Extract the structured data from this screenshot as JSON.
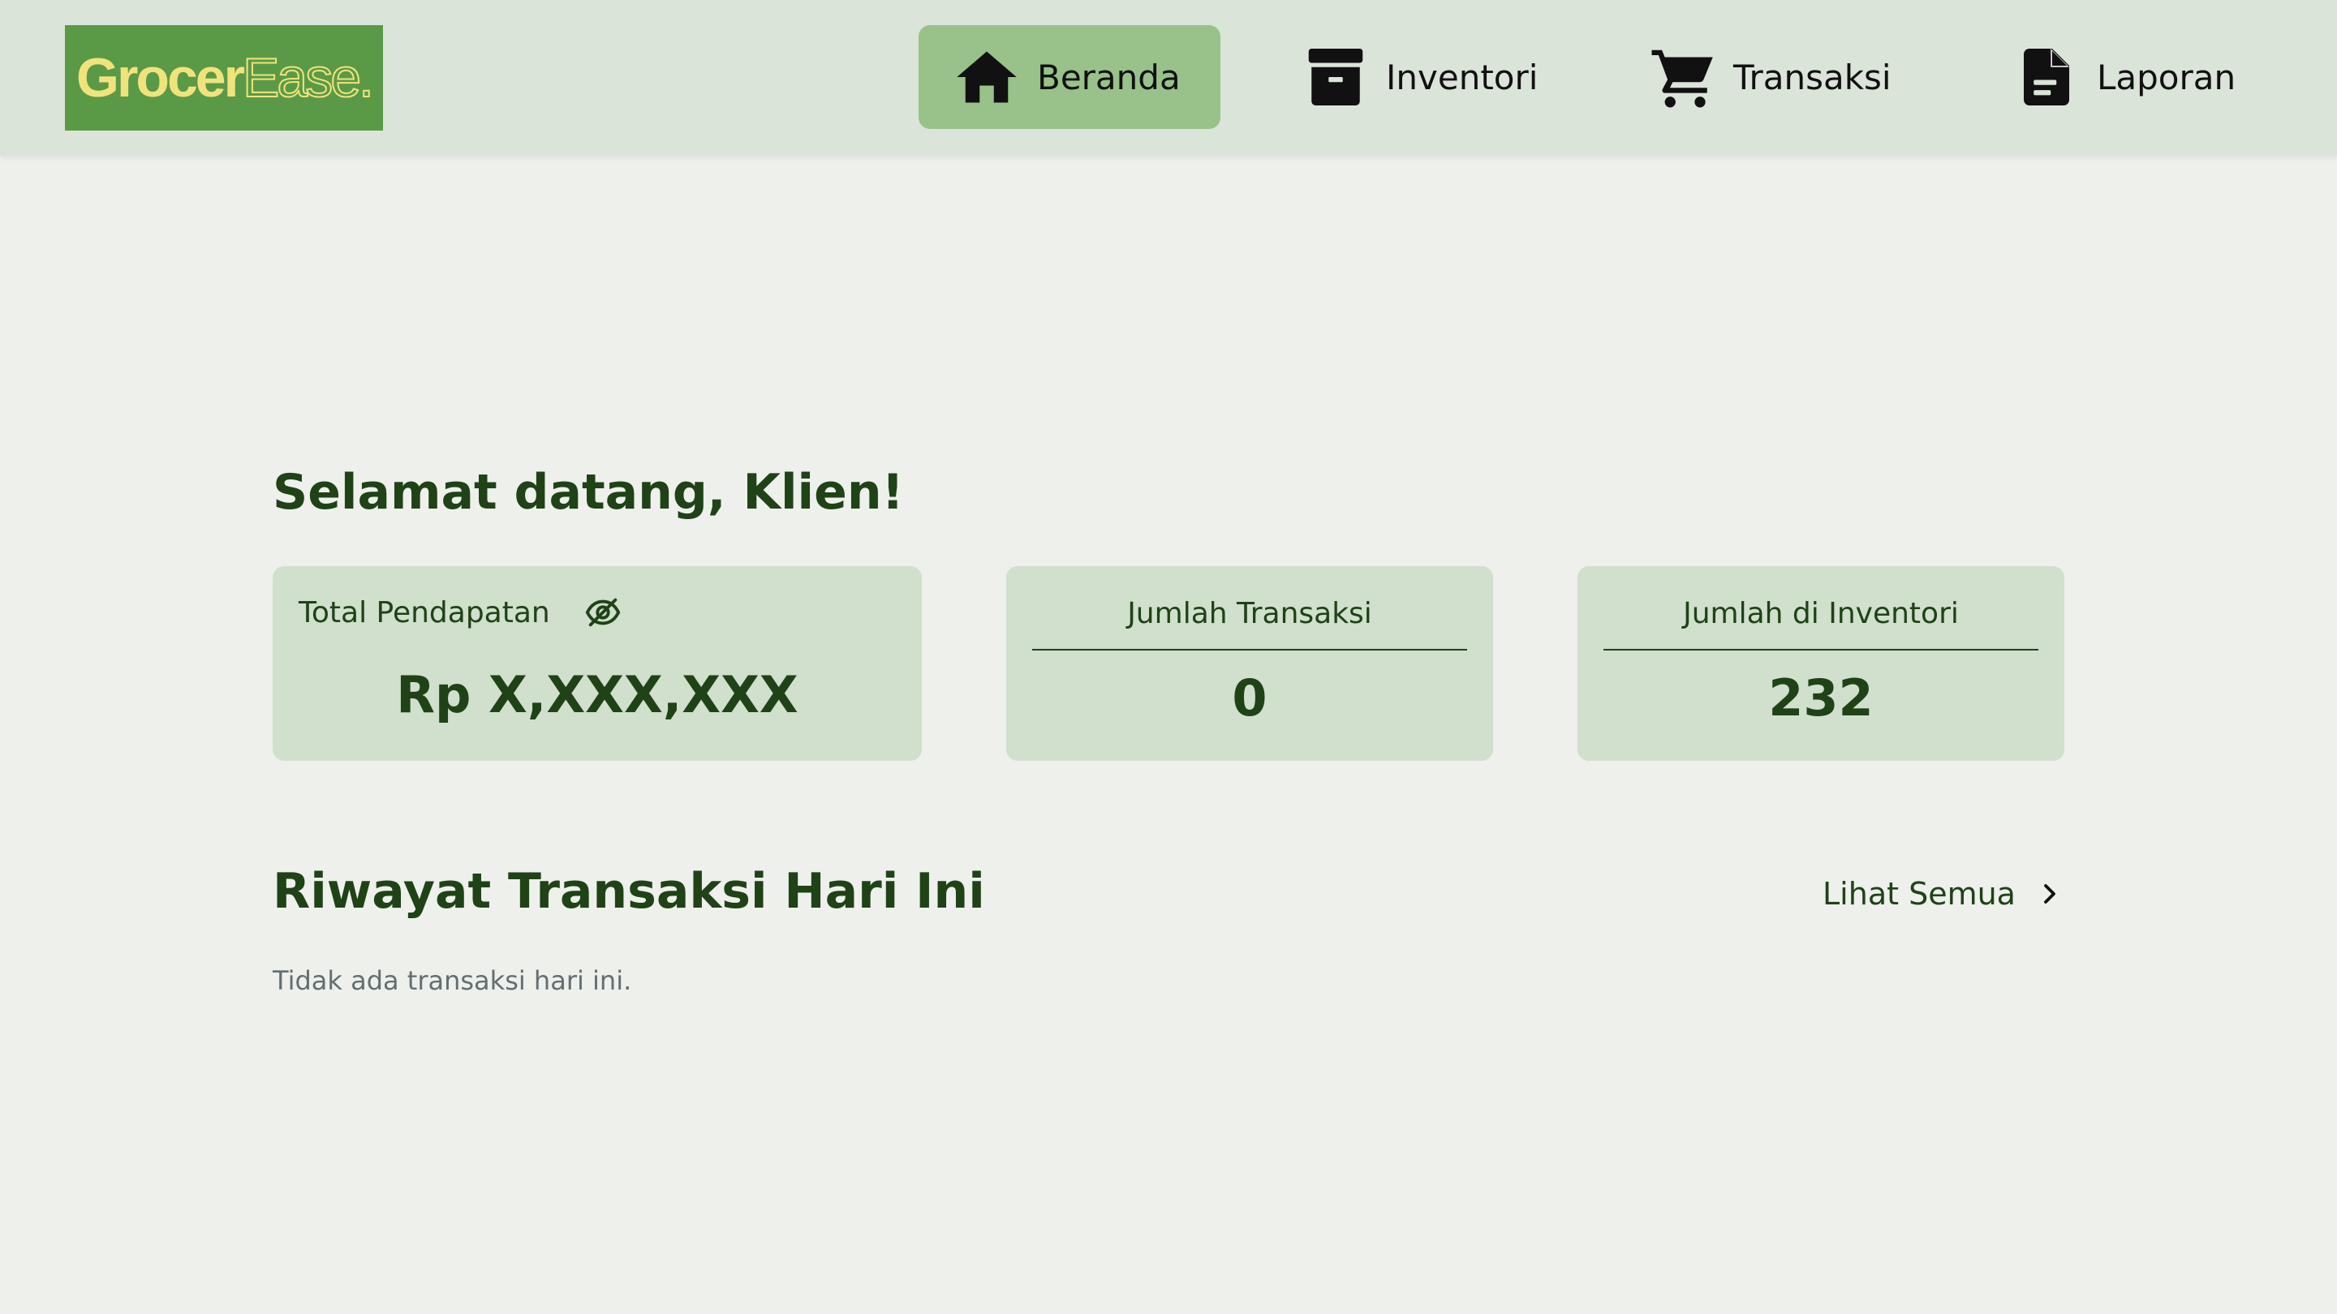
{
  "app": {
    "logo_part1": "Grocer",
    "logo_part2": "Ease."
  },
  "nav": {
    "items": [
      {
        "label": "Beranda",
        "icon": "home-icon",
        "active": true
      },
      {
        "label": "Inventori",
        "icon": "archive-box-icon",
        "active": false
      },
      {
        "label": "Transaksi",
        "icon": "shopping-cart-icon",
        "active": false
      },
      {
        "label": "Laporan",
        "icon": "document-icon",
        "active": false
      }
    ]
  },
  "welcome": "Selamat datang, Klien!",
  "cards": {
    "revenue": {
      "title": "Total Pendapatan",
      "value": "Rp X,XXX,XXX",
      "toggle_icon": "eye-slash-icon"
    },
    "transactions": {
      "title": "Jumlah Transaksi",
      "value": "0"
    },
    "inventory": {
      "title": "Jumlah di Inventori",
      "value": "232"
    }
  },
  "history": {
    "title": "Riwayat Transaksi Hari Ini",
    "see_all": "Lihat Semua",
    "empty": "Tidak ada transaksi hari ini."
  },
  "colors": {
    "topbar_bg": "#dbe4d9",
    "page_bg": "#eef0ec",
    "active_nav": "#98c28a",
    "card_bg": "#d1dfcd",
    "brand_green": "#5a9a47",
    "brand_yellow": "#f1e37c",
    "text_dark_green": "#1f4217",
    "muted_text": "#626f72"
  }
}
